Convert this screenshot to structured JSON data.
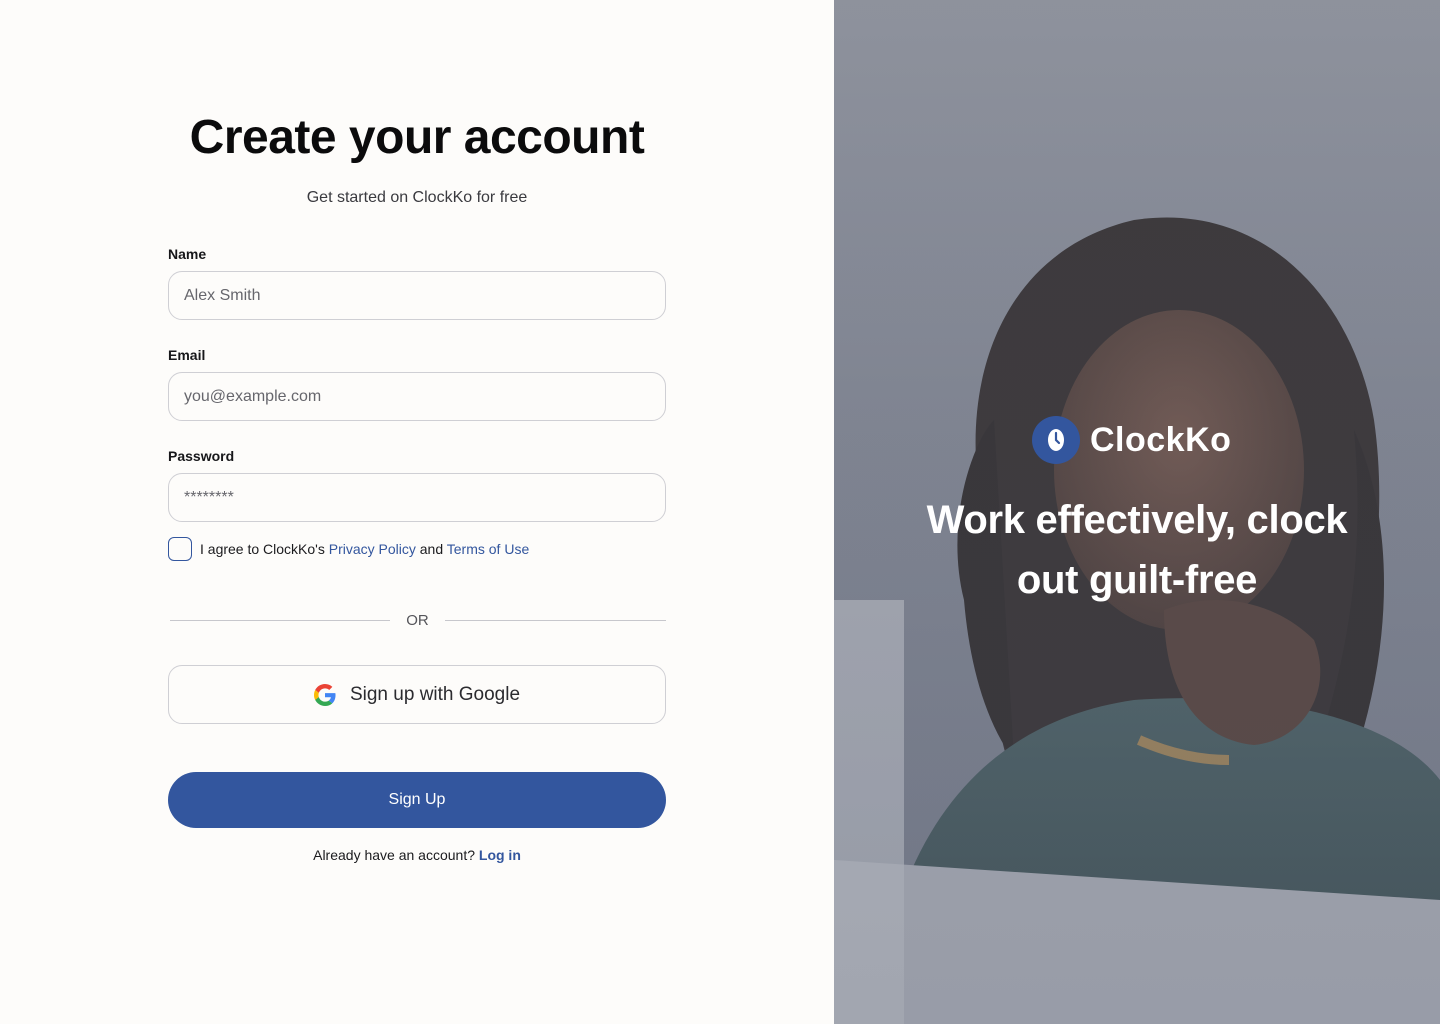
{
  "form": {
    "title": "Create your account",
    "subtitle": "Get started on ClockKo for free",
    "name": {
      "label": "Name",
      "placeholder": "Alex Smith"
    },
    "email": {
      "label": "Email",
      "placeholder": "you@example.com"
    },
    "password": {
      "label": "Password",
      "placeholder": "********"
    },
    "agree": {
      "prefix": "I agree to ClockKo's ",
      "privacy_link": "Privacy Policy",
      "middle": " and ",
      "terms_link": "Terms of Use"
    },
    "divider_text": "OR",
    "google_button": "Sign up with Google",
    "signup_button": "Sign Up",
    "login_prompt": "Already have an account?",
    "login_link": "Log in"
  },
  "hero": {
    "brand_name": "ClockKo",
    "tagline_line1": "Work effectively, clock",
    "tagline_line2": "out guilt-free"
  },
  "colors": {
    "accent": "#33569e",
    "background": "#fdfcfa",
    "text": "#0b0b0c"
  },
  "icons": {
    "google": "google-icon",
    "brand": "clockko-logo-icon"
  }
}
